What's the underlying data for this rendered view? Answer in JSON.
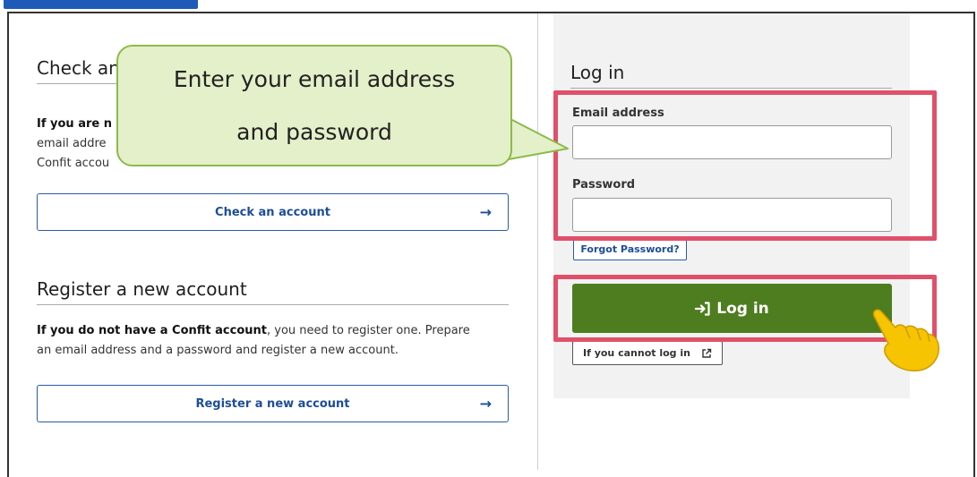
{
  "colors": {
    "primary_blue": "#2a5aa6",
    "login_green": "#4e7d1f",
    "highlight_red": "#e0506a",
    "callout_fill": "#e3f0c9",
    "callout_border": "#8cbb4a",
    "panel_bg": "#f1f2f1"
  },
  "check_section": {
    "title": "Check an account",
    "intro_bold": "If you are n",
    "line2": "email addre",
    "line3": "Confit accou",
    "button_label": "Check an account",
    "button_icon": "arrow-right-icon"
  },
  "register_section": {
    "title": "Register a new account",
    "para_bold": "If you do not have a Confit account",
    "para_rest": ", you need to register one. Prepare",
    "para_line2": "an email address and a password and register a new account.",
    "button_label": "Register a new account",
    "button_icon": "arrow-right-icon"
  },
  "login": {
    "title": "Log in",
    "email_label": "Email address",
    "email_value": "",
    "password_label": "Password",
    "password_value": "",
    "forgot_label": "Forgot Password?",
    "login_button_label": "Log in",
    "login_icon": "sign-in-icon",
    "cannot_login_label": "If you cannot log in",
    "external_icon": "external-link-icon"
  },
  "callout": {
    "line1": "Enter your email address",
    "line2": "and password"
  }
}
